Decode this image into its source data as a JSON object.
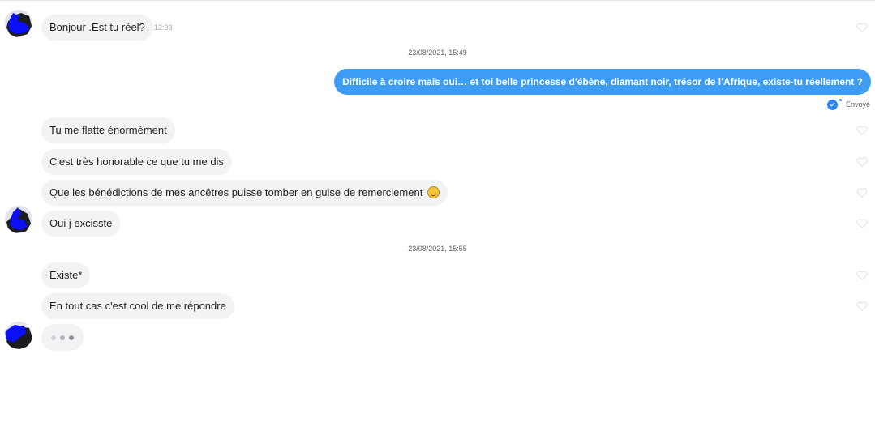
{
  "conversation": {
    "messages_received_1": [
      {
        "text": "Bonjour .Est tu réel?",
        "time": "12:33"
      }
    ],
    "date_separator_1": "23/08/2021, 15:49",
    "message_sent": {
      "text": "Difficile à croire mais oui… et toi belle princesse d'ébène, diamant noir, trésor de l'Afrique, existe-tu réellement ?",
      "status": "Envoyé"
    },
    "messages_received_2": [
      {
        "text": "Tu me flatte énormément"
      },
      {
        "text": "C'est très honorable ce que tu me dis"
      },
      {
        "text": "Que les bénédictions de mes ancêtres puisse tomber en guise de remerciement",
        "emoji": "smiling-face-emoji"
      },
      {
        "text": "Oui j excisste"
      }
    ],
    "date_separator_2": "23/08/2021, 15:55",
    "messages_received_3": [
      {
        "text": "Existe*"
      },
      {
        "text": "En tout cas c'est cool de me répondre"
      }
    ],
    "typing_indicator": {
      "dots": 3
    }
  },
  "colors": {
    "outgoing_bubble": "#3d9df5",
    "incoming_bubble": "#f2f3f5",
    "sent_check": "#2d86f2",
    "heart_outline": "#e3e3e8"
  },
  "icons": {
    "heart": "heart-outline-icon",
    "sent": "double-check-icon",
    "avatar": "user-avatar"
  }
}
